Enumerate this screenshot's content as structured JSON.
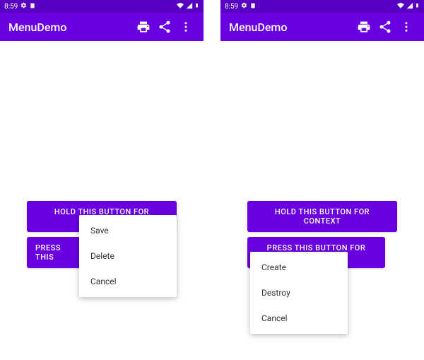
{
  "status": {
    "time": "8:59",
    "gear_icon": "gear-icon",
    "card_icon": "card-icon",
    "wifi_icon": "wifi-icon",
    "signal_icon": "signal-icon",
    "battery_icon": "battery-icon"
  },
  "appbar": {
    "title": "MenuDemo",
    "print_icon": "print-icon",
    "share_icon": "share-icon",
    "overflow_icon": "overflow-icon"
  },
  "colors": {
    "primary": "#6a00e0",
    "primary_dark": "#5800c2"
  },
  "left_screen": {
    "button_context_label": "HOLD THIS BUTTON FOR CONTEXT",
    "button_popup_label_truncated": "PRESS THIS",
    "context_menu": {
      "items": [
        "Save",
        "Delete",
        "Cancel"
      ]
    }
  },
  "right_screen": {
    "button_context_label": "HOLD THIS BUTTON FOR CONTEXT",
    "button_popup_label": "PRESS THIS BUTTON FOR POPUP",
    "popup_menu": {
      "items": [
        "Create",
        "Destroy",
        "Cancel"
      ]
    }
  }
}
